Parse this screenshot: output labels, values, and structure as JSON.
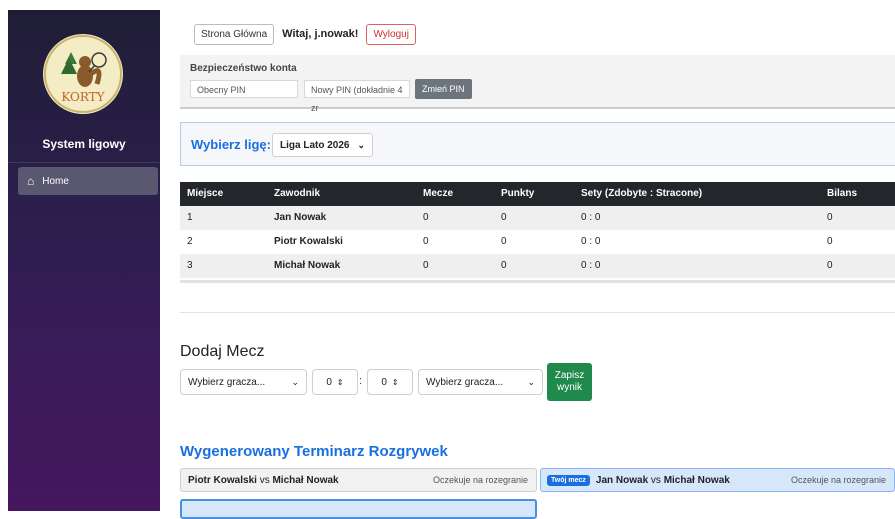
{
  "sidebar": {
    "brand": "System ligowy",
    "logo_text": "KORTY",
    "nav": [
      {
        "label": "Home",
        "icon": "home-icon"
      }
    ]
  },
  "topbar": {
    "home_button": "Strona Główna",
    "welcome": "Witaj, j.nowak!",
    "logout_button": "Wyloguj"
  },
  "security": {
    "title": "Bezpieczeństwo konta",
    "current_pin_placeholder": "Obecny PIN",
    "new_pin_placeholder": "Nowy PIN (dokładnie 4 zr",
    "change_button": "Zmień PIN"
  },
  "league": {
    "label": "Wybierz ligę:",
    "selected": "Liga Lato 2026"
  },
  "standings": {
    "headers": [
      "Miejsce",
      "Zawodnik",
      "Mecze",
      "Punkty",
      "Sety (Zdobyte : Stracone)",
      "Bilans"
    ],
    "rows": [
      {
        "place": "1",
        "player": "Jan Nowak",
        "matches": "0",
        "points": "0",
        "sets": "0 : 0",
        "balance": "0"
      },
      {
        "place": "2",
        "player": "Piotr Kowalski",
        "matches": "0",
        "points": "0",
        "sets": "0 : 0",
        "balance": "0"
      },
      {
        "place": "3",
        "player": "Michał Nowak",
        "matches": "0",
        "points": "0",
        "sets": "0 : 0",
        "balance": "0"
      }
    ]
  },
  "add_match": {
    "title": "Dodaj Mecz",
    "player1_placeholder": "Wybierz gracza...",
    "score1": "0",
    "separator": ":",
    "score2": "0",
    "player2_placeholder": "Wybierz gracza...",
    "save_line1": "Zapisz",
    "save_line2": "wynik"
  },
  "schedule": {
    "title": "Wygenerowany Terminarz Rozgrywek",
    "matches": [
      {
        "player1": "Piotr Kowalski",
        "vs": "vs",
        "player2": "Michał Nowak",
        "status": "Oczekuje na rozegranie",
        "badge": ""
      },
      {
        "player1": "Jan Nowak",
        "vs": "vs",
        "player2": "Michał Nowak",
        "status": "Oczekuje na rozegranie",
        "badge": "Twój mecz"
      }
    ]
  }
}
